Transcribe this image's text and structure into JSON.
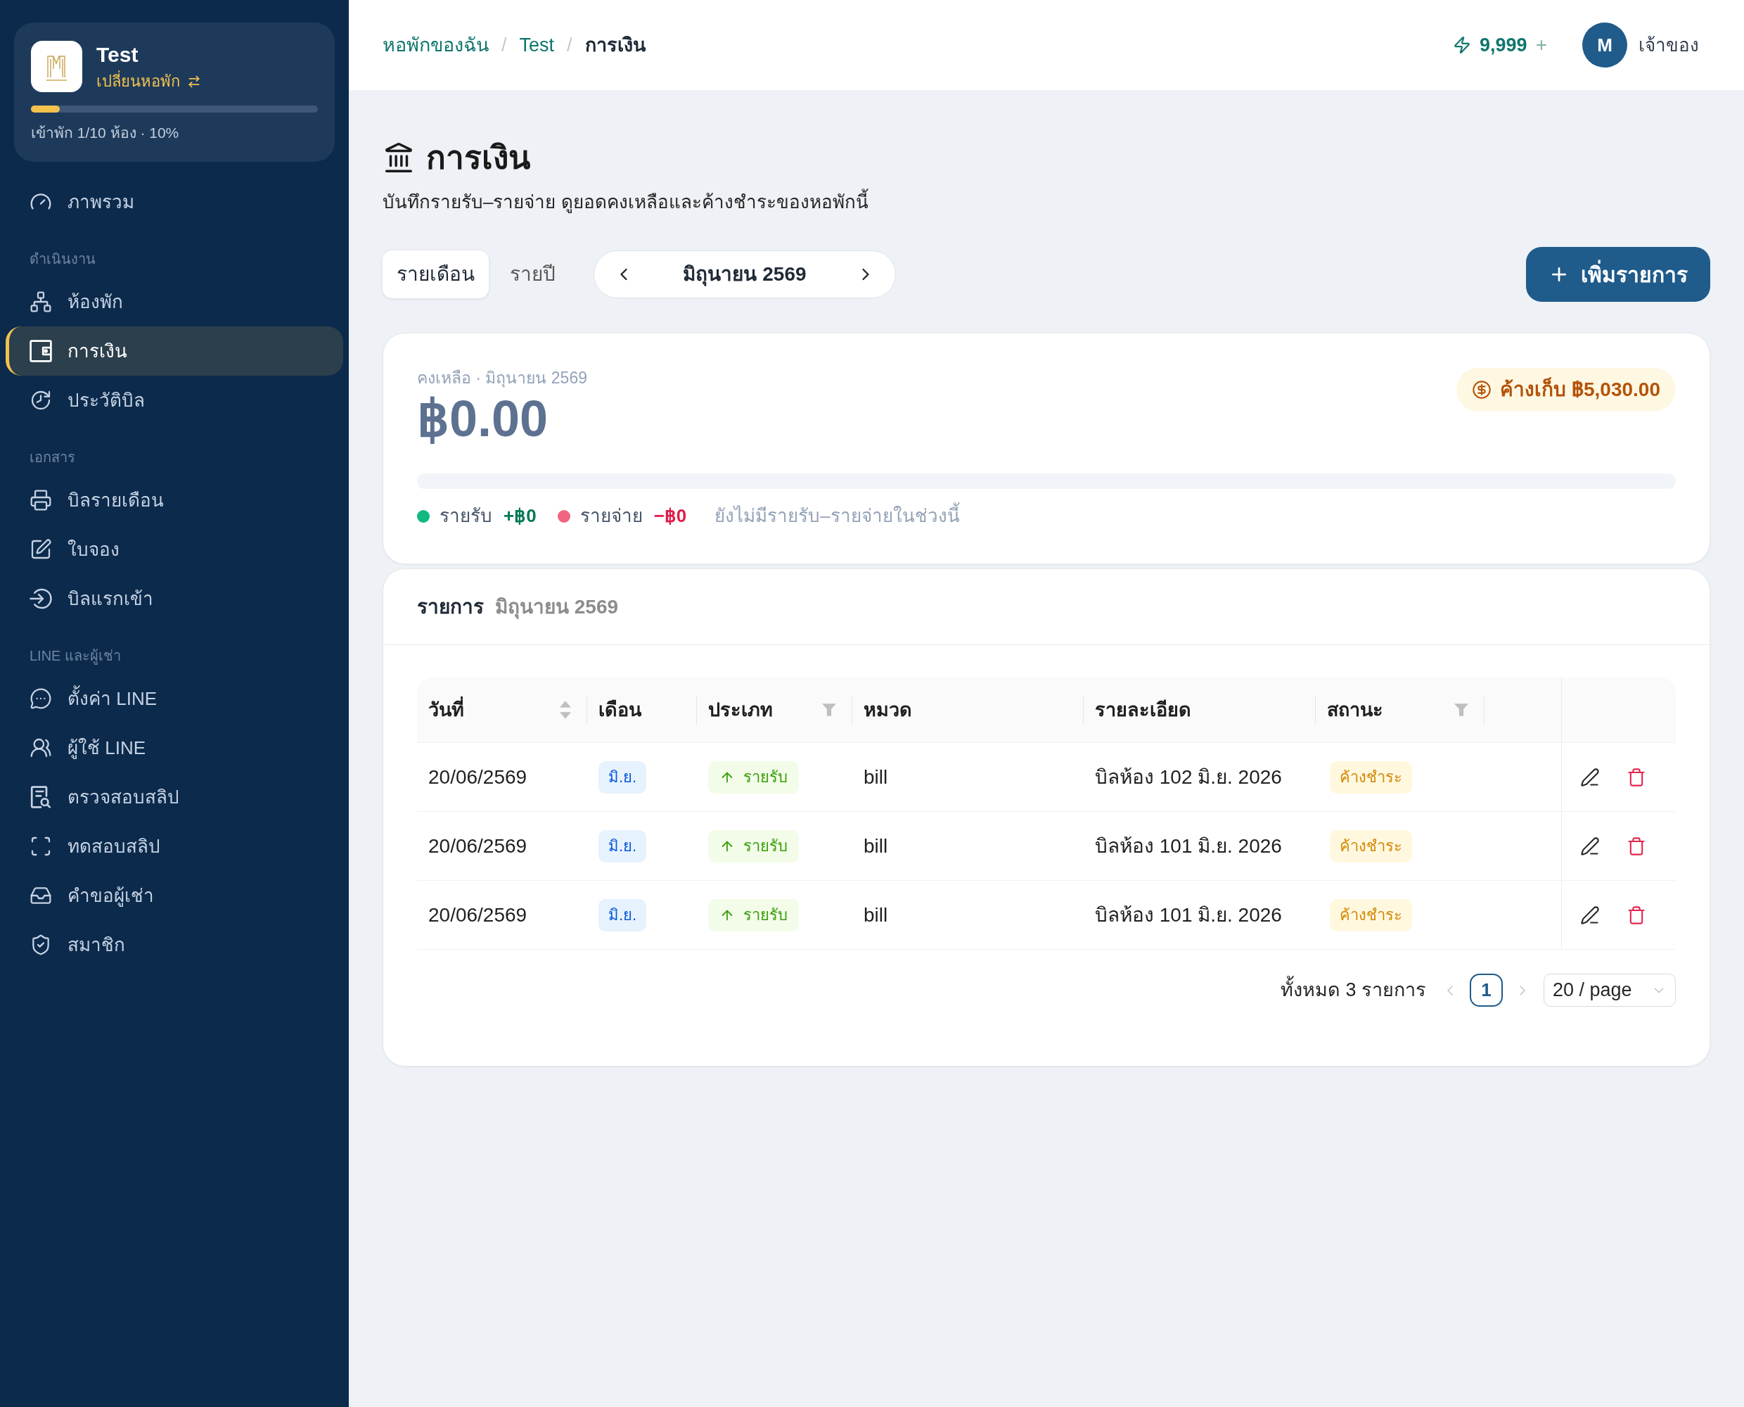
{
  "sidebar": {
    "property": {
      "name": "Test",
      "switch_label": "เปลี่ยนหอพัก",
      "occupancy": {
        "level": 0.1,
        "label": "เข้าพัก 1/10 ห้อง · 10%"
      }
    },
    "nav": [
      {
        "items": [
          {
            "label": "ภาพรวม",
            "selected": false
          }
        ]
      },
      {
        "heading": "ดำเนินงาน",
        "items": [
          {
            "label": "ห้องพัก",
            "selected": false
          },
          {
            "label": "การเงิน",
            "selected": true
          },
          {
            "label": "ประวัติบิล",
            "selected": false
          }
        ]
      },
      {
        "heading": "เอกสาร",
        "items": [
          {
            "label": "บิลรายเดือน",
            "selected": false
          },
          {
            "label": "ใบจอง",
            "selected": false
          },
          {
            "label": "บิลแรกเข้า",
            "selected": false
          }
        ]
      },
      {
        "heading": "LINE และผู้เช่า",
        "items": [
          {
            "label": "ตั้งค่า LINE",
            "selected": false
          },
          {
            "label": "ผู้ใช้ LINE",
            "selected": false
          },
          {
            "label": "ตรวจสอบสลิป",
            "selected": false
          },
          {
            "label": "ทดสอบสลิป",
            "selected": false
          },
          {
            "label": "คำขอผู้เช่า",
            "selected": false
          },
          {
            "label": "สมาชิก",
            "selected": false
          }
        ]
      }
    ]
  },
  "header": {
    "breadcrumbs": [
      {
        "kind": "link",
        "label": "หอพักของฉัน"
      },
      {
        "kind": "separator",
        "label": "/"
      },
      {
        "kind": "link",
        "label": "Test"
      },
      {
        "kind": "separator",
        "label": "/"
      },
      {
        "kind": "current",
        "label": "การเงิน"
      }
    ],
    "credits": {
      "amount": "9,999",
      "add": "+"
    },
    "user": {
      "initial": "M",
      "role": "เจ้าของ"
    }
  },
  "page": {
    "title": "การเงิน",
    "subtitle": "บันทึกรายรับ–รายจ่าย ดูยอดคงเหลือและค้างชำระของหอพักนี้"
  },
  "toolbar": {
    "period_tabs": [
      {
        "label": "รายเดือน",
        "selected": true
      },
      {
        "label": "รายปี",
        "selected": false
      }
    ],
    "month_picker": {
      "value": "มิถุนายน 2569"
    },
    "add_button": {
      "label": "เพิ่มรายการ"
    }
  },
  "summary": {
    "caption": "คงเหลือ · มิถุนายน 2569",
    "balance": "฿0.00",
    "outstanding": "ค้างเก็บ ฿5,030.00",
    "legend": [
      {
        "kind": "income",
        "label": "รายรับ",
        "amount": "+฿0",
        "color": "#10b981"
      },
      {
        "kind": "expense",
        "label": "รายจ่าย",
        "amount": "−฿0",
        "color": "#f16581"
      }
    ],
    "note": "ยังไม่มีรายรับ–รายจ่ายในช่วงนี้"
  },
  "transactions": {
    "title": "รายการ",
    "period": "มิถุนายน 2569",
    "columns": [
      {
        "label": "วันที่",
        "sortable": true,
        "filterable": false
      },
      {
        "label": "เดือน",
        "sortable": false,
        "filterable": false
      },
      {
        "label": "ประเภท",
        "sortable": false,
        "filterable": true
      },
      {
        "label": "หมวด",
        "sortable": false,
        "filterable": false
      },
      {
        "label": "รายละเอียด",
        "sortable": false,
        "filterable": false
      },
      {
        "label": "สถานะ",
        "sortable": false,
        "filterable": true
      }
    ],
    "rows": [
      {
        "date": "20/06/2569",
        "month": "มิ.ย.",
        "type": {
          "kind": "income",
          "label": "รายรับ"
        },
        "category": "bill",
        "detail": "บิลห้อง 102 มิ.ย. 2026",
        "status": {
          "kind": "unpaid",
          "label": "ค้างชำระ"
        }
      },
      {
        "date": "20/06/2569",
        "month": "มิ.ย.",
        "type": {
          "kind": "income",
          "label": "รายรับ"
        },
        "category": "bill",
        "detail": "บิลห้อง 101 มิ.ย. 2026",
        "status": {
          "kind": "unpaid",
          "label": "ค้างชำระ"
        }
      },
      {
        "date": "20/06/2569",
        "month": "มิ.ย.",
        "type": {
          "kind": "income",
          "label": "รายรับ"
        },
        "category": "bill",
        "detail": "บิลห้อง 101 มิ.ย. 2026",
        "status": {
          "kind": "unpaid",
          "label": "ค้างชำระ"
        }
      }
    ],
    "pagination": {
      "total": "ทั้งหมด 3 รายการ",
      "pages": [
        {
          "label": "1",
          "selected": true
        }
      ],
      "page_size": "20 / page"
    }
  }
}
